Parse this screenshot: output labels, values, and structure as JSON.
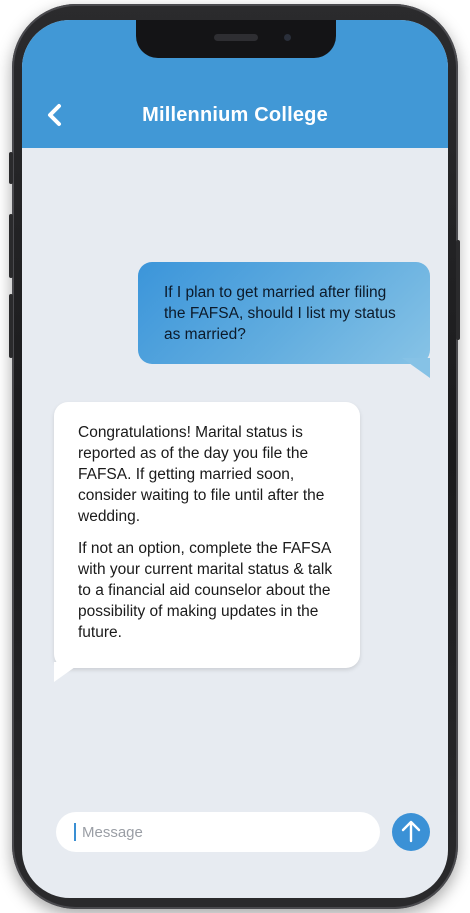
{
  "header": {
    "title": "Millennium College",
    "back_icon": "chevron-left-icon",
    "background_color": "#4198d6"
  },
  "messages": [
    {
      "direction": "outgoing",
      "text": "If I plan to get married after filing the FAFSA, should I list my status as married?"
    },
    {
      "direction": "incoming",
      "paragraphs": [
        "Congratulations!  Marital status is reported as of the day you file the FAFSA. If getting married soon, consider waiting to file until after the wedding.",
        "If not an option, complete the FAFSA with your current marital status & talk to a financial aid counselor about the possibility of making updates in the future."
      ]
    }
  ],
  "composer": {
    "placeholder": "Message",
    "value": "",
    "send_icon": "arrow-up-icon",
    "send_color": "#3b91d6"
  }
}
